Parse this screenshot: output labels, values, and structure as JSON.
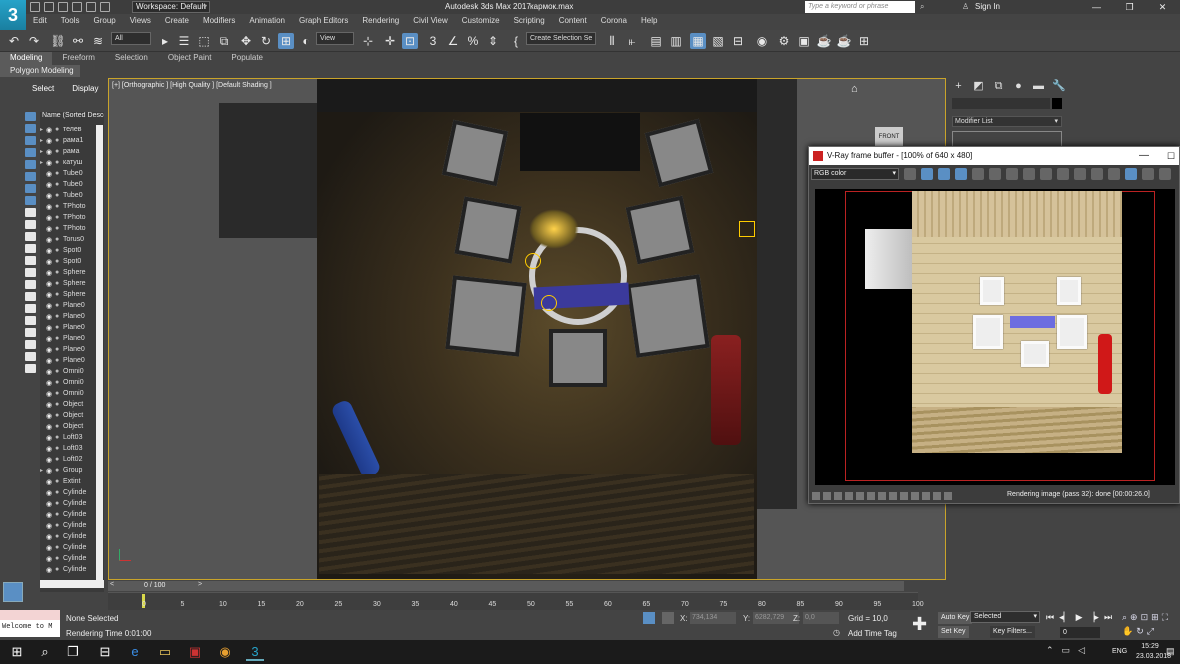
{
  "titlebar": {
    "app_title": "Autodesk 3ds Max 2017",
    "file_name": "кармок.max",
    "workspace": "Workspace: Default",
    "search_placeholder": "Type a keyword or phrase",
    "sign_in": "Sign In"
  },
  "menu": [
    "Edit",
    "Tools",
    "Group",
    "Views",
    "Create",
    "Modifiers",
    "Animation",
    "Graph Editors",
    "Rendering",
    "Civil View",
    "Customize",
    "Scripting",
    "Content",
    "Corona",
    "Help"
  ],
  "toolbar": {
    "selection_filter": "All",
    "ref_coord": "View",
    "named_selection": "Create Selection Se"
  },
  "ribbon": {
    "tabs": [
      "Modeling",
      "Freeform",
      "Selection",
      "Object Paint",
      "Populate"
    ],
    "sub_label": "Polygon Modeling"
  },
  "scene_explorer": {
    "tabs": [
      "Select",
      "Display"
    ],
    "header": "Name (Sorted Descending)",
    "items": [
      "телев",
      "рама1",
      "рама",
      "катуш",
      "Tube0",
      "Tube0",
      "Tube0",
      "TPhoto",
      "TPhoto",
      "TPhoto",
      "Torus0",
      "Spot0",
      "Spot0",
      "Sphere",
      "Sphere",
      "Sphere",
      "Plane0",
      "Plane0",
      "Plane0",
      "Plane0",
      "Plane0",
      "Plane0",
      "Omni0",
      "Omni0",
      "Omni0",
      "Object",
      "Object",
      "Object",
      "Loft03",
      "Loft03",
      "Loft02",
      "Group",
      "Extint",
      "Cylinde",
      "Cylinde",
      "Cylinde",
      "Cylinde",
      "Cylinde",
      "Cylinde",
      "Cylinde",
      "Cylinde"
    ]
  },
  "viewport": {
    "label": "[+] [Orthographic ] [High Quality ] [Default Shading ]",
    "viewcube_label": "FRONT"
  },
  "command_panel": {
    "modifier_list": "Modifier List"
  },
  "vfb": {
    "title": "V-Ray frame buffer - [100% of 640 x 480]",
    "channel": "RGB color",
    "status": "Rendering image (pass 32): done [00:00:26.0]"
  },
  "timeline": {
    "slider_label": "0 / 100",
    "ticks": [
      "0",
      "5",
      "10",
      "15",
      "20",
      "25",
      "30",
      "35",
      "40",
      "45",
      "50",
      "55",
      "60",
      "65",
      "70",
      "75",
      "80",
      "85",
      "90",
      "95",
      "100"
    ]
  },
  "statusbar": {
    "maxscript": "Welcome to M",
    "selection": "None Selected",
    "render_time": "Rendering Time 0:01:00",
    "x_label": "X:",
    "x_value": "734,134",
    "y_label": "Y:",
    "y_value": "6282,729",
    "z_label": "Z:",
    "z_value": "0,0",
    "grid": "Grid = 10,0",
    "add_time_tag": "Add Time Tag",
    "auto_key": "Auto Key",
    "set_key": "Set Key",
    "selected_dd": "Selected",
    "key_filters": "Key Filters...",
    "frame": "0"
  },
  "taskbar": {
    "lang": "ENG",
    "time": "15:29",
    "date": "23.03.2018"
  },
  "colors": {
    "accent": "#5a8fc4",
    "viewport_border": "#c9a42a",
    "render_region": "#b22222"
  }
}
